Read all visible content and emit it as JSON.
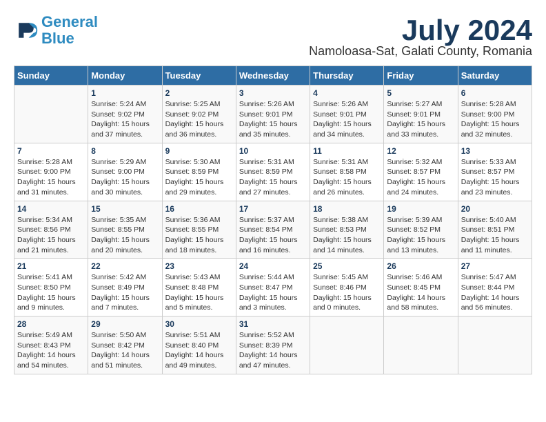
{
  "logo": {
    "line1": "General",
    "line2": "Blue"
  },
  "title": "July 2024",
  "location": "Namoloasa-Sat, Galati County, Romania",
  "days_of_week": [
    "Sunday",
    "Monday",
    "Tuesday",
    "Wednesday",
    "Thursday",
    "Friday",
    "Saturday"
  ],
  "weeks": [
    [
      {
        "day": "",
        "info": ""
      },
      {
        "day": "1",
        "info": "Sunrise: 5:24 AM\nSunset: 9:02 PM\nDaylight: 15 hours\nand 37 minutes."
      },
      {
        "day": "2",
        "info": "Sunrise: 5:25 AM\nSunset: 9:02 PM\nDaylight: 15 hours\nand 36 minutes."
      },
      {
        "day": "3",
        "info": "Sunrise: 5:26 AM\nSunset: 9:01 PM\nDaylight: 15 hours\nand 35 minutes."
      },
      {
        "day": "4",
        "info": "Sunrise: 5:26 AM\nSunset: 9:01 PM\nDaylight: 15 hours\nand 34 minutes."
      },
      {
        "day": "5",
        "info": "Sunrise: 5:27 AM\nSunset: 9:01 PM\nDaylight: 15 hours\nand 33 minutes."
      },
      {
        "day": "6",
        "info": "Sunrise: 5:28 AM\nSunset: 9:00 PM\nDaylight: 15 hours\nand 32 minutes."
      }
    ],
    [
      {
        "day": "7",
        "info": "Sunrise: 5:28 AM\nSunset: 9:00 PM\nDaylight: 15 hours\nand 31 minutes."
      },
      {
        "day": "8",
        "info": "Sunrise: 5:29 AM\nSunset: 9:00 PM\nDaylight: 15 hours\nand 30 minutes."
      },
      {
        "day": "9",
        "info": "Sunrise: 5:30 AM\nSunset: 8:59 PM\nDaylight: 15 hours\nand 29 minutes."
      },
      {
        "day": "10",
        "info": "Sunrise: 5:31 AM\nSunset: 8:59 PM\nDaylight: 15 hours\nand 27 minutes."
      },
      {
        "day": "11",
        "info": "Sunrise: 5:31 AM\nSunset: 8:58 PM\nDaylight: 15 hours\nand 26 minutes."
      },
      {
        "day": "12",
        "info": "Sunrise: 5:32 AM\nSunset: 8:57 PM\nDaylight: 15 hours\nand 24 minutes."
      },
      {
        "day": "13",
        "info": "Sunrise: 5:33 AM\nSunset: 8:57 PM\nDaylight: 15 hours\nand 23 minutes."
      }
    ],
    [
      {
        "day": "14",
        "info": "Sunrise: 5:34 AM\nSunset: 8:56 PM\nDaylight: 15 hours\nand 21 minutes."
      },
      {
        "day": "15",
        "info": "Sunrise: 5:35 AM\nSunset: 8:55 PM\nDaylight: 15 hours\nand 20 minutes."
      },
      {
        "day": "16",
        "info": "Sunrise: 5:36 AM\nSunset: 8:55 PM\nDaylight: 15 hours\nand 18 minutes."
      },
      {
        "day": "17",
        "info": "Sunrise: 5:37 AM\nSunset: 8:54 PM\nDaylight: 15 hours\nand 16 minutes."
      },
      {
        "day": "18",
        "info": "Sunrise: 5:38 AM\nSunset: 8:53 PM\nDaylight: 15 hours\nand 14 minutes."
      },
      {
        "day": "19",
        "info": "Sunrise: 5:39 AM\nSunset: 8:52 PM\nDaylight: 15 hours\nand 13 minutes."
      },
      {
        "day": "20",
        "info": "Sunrise: 5:40 AM\nSunset: 8:51 PM\nDaylight: 15 hours\nand 11 minutes."
      }
    ],
    [
      {
        "day": "21",
        "info": "Sunrise: 5:41 AM\nSunset: 8:50 PM\nDaylight: 15 hours\nand 9 minutes."
      },
      {
        "day": "22",
        "info": "Sunrise: 5:42 AM\nSunset: 8:49 PM\nDaylight: 15 hours\nand 7 minutes."
      },
      {
        "day": "23",
        "info": "Sunrise: 5:43 AM\nSunset: 8:48 PM\nDaylight: 15 hours\nand 5 minutes."
      },
      {
        "day": "24",
        "info": "Sunrise: 5:44 AM\nSunset: 8:47 PM\nDaylight: 15 hours\nand 3 minutes."
      },
      {
        "day": "25",
        "info": "Sunrise: 5:45 AM\nSunset: 8:46 PM\nDaylight: 15 hours\nand 0 minutes."
      },
      {
        "day": "26",
        "info": "Sunrise: 5:46 AM\nSunset: 8:45 PM\nDaylight: 14 hours\nand 58 minutes."
      },
      {
        "day": "27",
        "info": "Sunrise: 5:47 AM\nSunset: 8:44 PM\nDaylight: 14 hours\nand 56 minutes."
      }
    ],
    [
      {
        "day": "28",
        "info": "Sunrise: 5:49 AM\nSunset: 8:43 PM\nDaylight: 14 hours\nand 54 minutes."
      },
      {
        "day": "29",
        "info": "Sunrise: 5:50 AM\nSunset: 8:42 PM\nDaylight: 14 hours\nand 51 minutes."
      },
      {
        "day": "30",
        "info": "Sunrise: 5:51 AM\nSunset: 8:40 PM\nDaylight: 14 hours\nand 49 minutes."
      },
      {
        "day": "31",
        "info": "Sunrise: 5:52 AM\nSunset: 8:39 PM\nDaylight: 14 hours\nand 47 minutes."
      },
      {
        "day": "",
        "info": ""
      },
      {
        "day": "",
        "info": ""
      },
      {
        "day": "",
        "info": ""
      }
    ]
  ]
}
